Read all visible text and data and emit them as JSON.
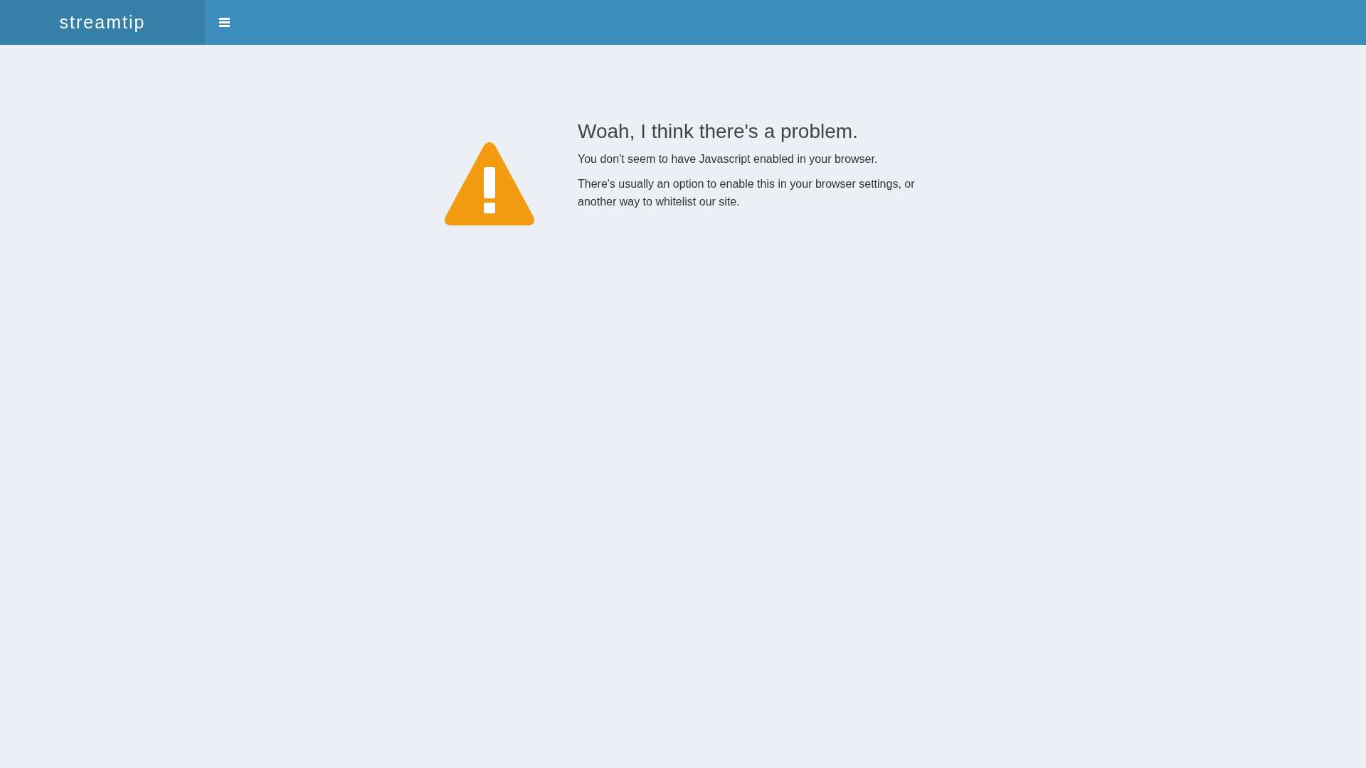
{
  "header": {
    "logo": "streamtip"
  },
  "message": {
    "title": "Woah, I think there's a problem.",
    "paragraphs": [
      "You don't seem to have Javascript enabled in your browser.",
      "There's usually an option to enable this in your browser settings, or another way to whitelist our site."
    ]
  }
}
